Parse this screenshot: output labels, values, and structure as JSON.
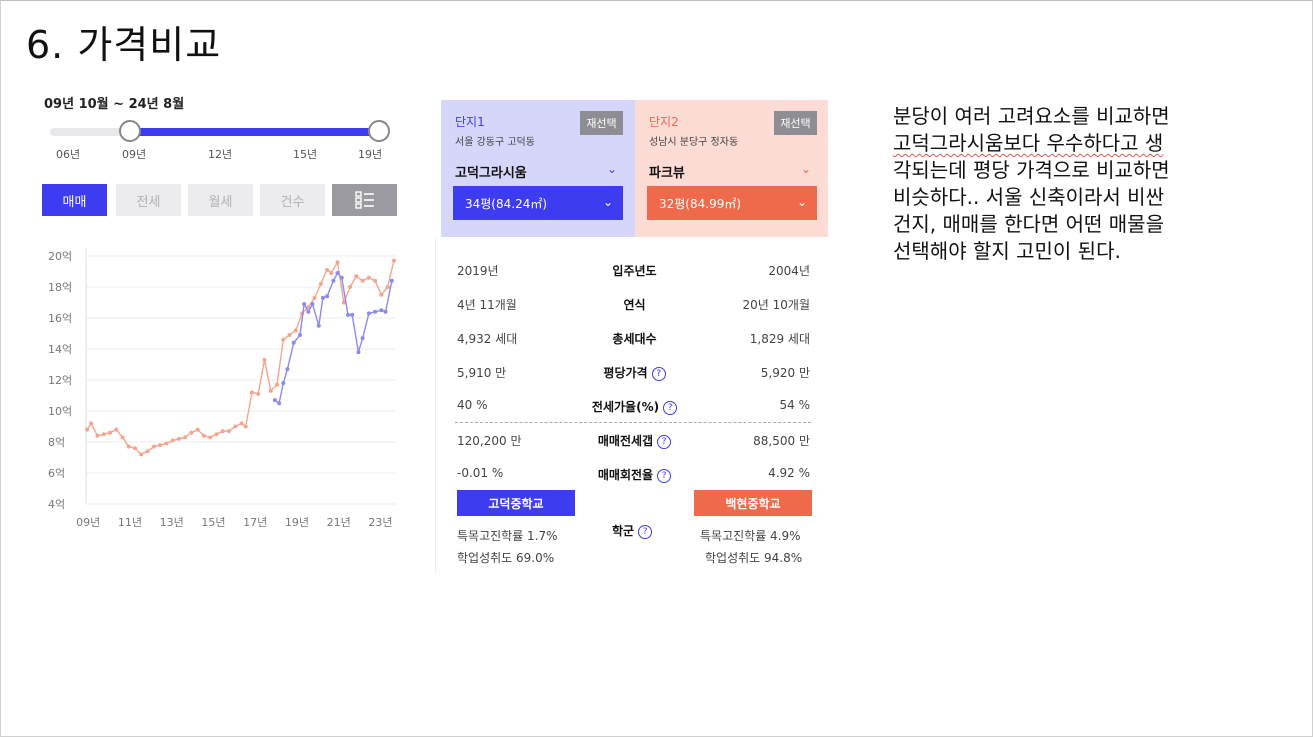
{
  "slide": {
    "title": "6. 가격비교"
  },
  "chart_panel": {
    "period": "09년 10월 ~ 24년 8월",
    "slider": {
      "ticks": [
        "06년",
        "09년",
        "12년",
        "15년",
        "19년"
      ],
      "range_start_fraction": 0.24,
      "range_end_fraction": 0.99
    },
    "tabs": [
      {
        "label": "매매",
        "active": true
      },
      {
        "label": "전세",
        "active": false
      },
      {
        "label": "월세",
        "active": false
      },
      {
        "label": "건수",
        "active": false
      }
    ],
    "list_icon": "list-icon"
  },
  "chart_data": {
    "type": "line",
    "y_unit": "억",
    "yticks": [
      "20억",
      "18억",
      "16억",
      "14억",
      "12억",
      "10억",
      "8억",
      "6억",
      "4억"
    ],
    "xticks": [
      "09년",
      "11년",
      "13년",
      "15년",
      "17년",
      "19년",
      "21년",
      "23년"
    ],
    "ylim": [
      4,
      20
    ],
    "xlim": [
      2009.75,
      2024.6
    ],
    "grid": true,
    "series": [
      {
        "color": "#f4a58f",
        "x": [
          2009.8,
          2010.0,
          2010.3,
          2010.6,
          2010.9,
          2011.2,
          2011.5,
          2011.8,
          2012.1,
          2012.4,
          2012.7,
          2013.0,
          2013.3,
          2013.6,
          2013.9,
          2014.2,
          2014.5,
          2014.8,
          2015.1,
          2015.4,
          2015.7,
          2016.0,
          2016.3,
          2016.6,
          2016.9,
          2017.2,
          2017.4,
          2017.7,
          2018.0,
          2018.3,
          2018.6,
          2018.9,
          2019.2,
          2019.5,
          2019.8,
          2020.1,
          2020.4,
          2020.7,
          2021.0,
          2021.3,
          2021.5,
          2021.8,
          2022.1,
          2022.4,
          2022.7,
          2023.0,
          2023.3,
          2023.6,
          2023.9,
          2024.2,
          2024.5
        ],
        "values": [
          8.8,
          9.2,
          8.4,
          8.5,
          8.6,
          8.8,
          8.3,
          7.7,
          7.6,
          7.2,
          7.4,
          7.7,
          7.8,
          7.9,
          8.1,
          8.2,
          8.3,
          8.6,
          8.8,
          8.4,
          8.3,
          8.5,
          8.7,
          8.7,
          9.0,
          9.2,
          9.0,
          11.2,
          11.1,
          13.3,
          11.3,
          11.7,
          14.6,
          14.9,
          15.2,
          16.3,
          16.7,
          17.3,
          18.2,
          19.1,
          18.9,
          19.6,
          17.0,
          18.0,
          18.7,
          18.4,
          18.6,
          18.4,
          17.5,
          18.0,
          19.7
        ]
      },
      {
        "color": "#8a8af0",
        "x": [
          2018.8,
          2019.0,
          2019.2,
          2019.4,
          2019.7,
          2020.0,
          2020.2,
          2020.4,
          2020.6,
          2020.9,
          2021.1,
          2021.3,
          2021.6,
          2021.8,
          2022.0,
          2022.3,
          2022.5,
          2022.8,
          2023.0,
          2023.3,
          2023.6,
          2023.9,
          2024.1,
          2024.4
        ],
        "values": [
          10.7,
          10.5,
          11.8,
          12.7,
          14.4,
          14.9,
          16.9,
          16.4,
          16.9,
          15.5,
          17.3,
          17.4,
          18.4,
          18.9,
          18.6,
          16.2,
          16.2,
          13.8,
          14.7,
          16.3,
          16.4,
          16.5,
          16.4,
          18.4
        ]
      }
    ]
  },
  "compare": {
    "complex1": {
      "label": "단지1",
      "address": "서울 강동구 고덕동",
      "name": "고덕그라시움",
      "size": "34평(84.24㎡)",
      "reselect": "재선택",
      "color": "#3d3cf0"
    },
    "complex2": {
      "label": "단지2",
      "address": "성남시 분당구 정자동",
      "name": "파크뷰",
      "size": "32평(84.99㎡)",
      "reselect": "재선택",
      "color": "#ee6a4b"
    },
    "rows": [
      {
        "left": "2019년",
        "label": "입주년도",
        "right": "2004년",
        "help": false
      },
      {
        "left": "4년 11개월",
        "label": "연식",
        "right": "20년 10개월",
        "help": false
      },
      {
        "left": "4,932 세대",
        "label": "총세대수",
        "right": "1,829 세대",
        "help": false
      },
      {
        "left": "5,910 만",
        "label": "평당가격",
        "right": "5,920 만",
        "help": true
      },
      {
        "left": "40 %",
        "label": "전세가율(%)",
        "right": "54 %",
        "help": true
      },
      {
        "left": "120,200 만",
        "label": "매매전세갭",
        "right": "88,500 만",
        "help": true
      },
      {
        "left": "-0.01 %",
        "label": "매매회전율",
        "right": "4.92 %",
        "help": true
      }
    ],
    "school": {
      "label": "학군",
      "left_name": "고덕중학교",
      "right_name": "백현중학교",
      "left_line1": "특목고진학률 1.7%",
      "left_line2": "학업성취도 69.0%",
      "right_line1": "특목고진학률 4.9%",
      "right_line2": "학업성취도 94.8%"
    },
    "help_glyph": "?"
  },
  "notes": {
    "lines": [
      "분당이 여러 고려요소를 비교하면",
      "고덕그라시움보다 우수하다고 생",
      "각되는데 평당 가격으로 비교하면",
      "비슷하다.. 서울 신축이라서 비싼",
      "건지, 매매를 한다면 어떤 매물을",
      "선택해야 할지 고민이 된다."
    ]
  }
}
